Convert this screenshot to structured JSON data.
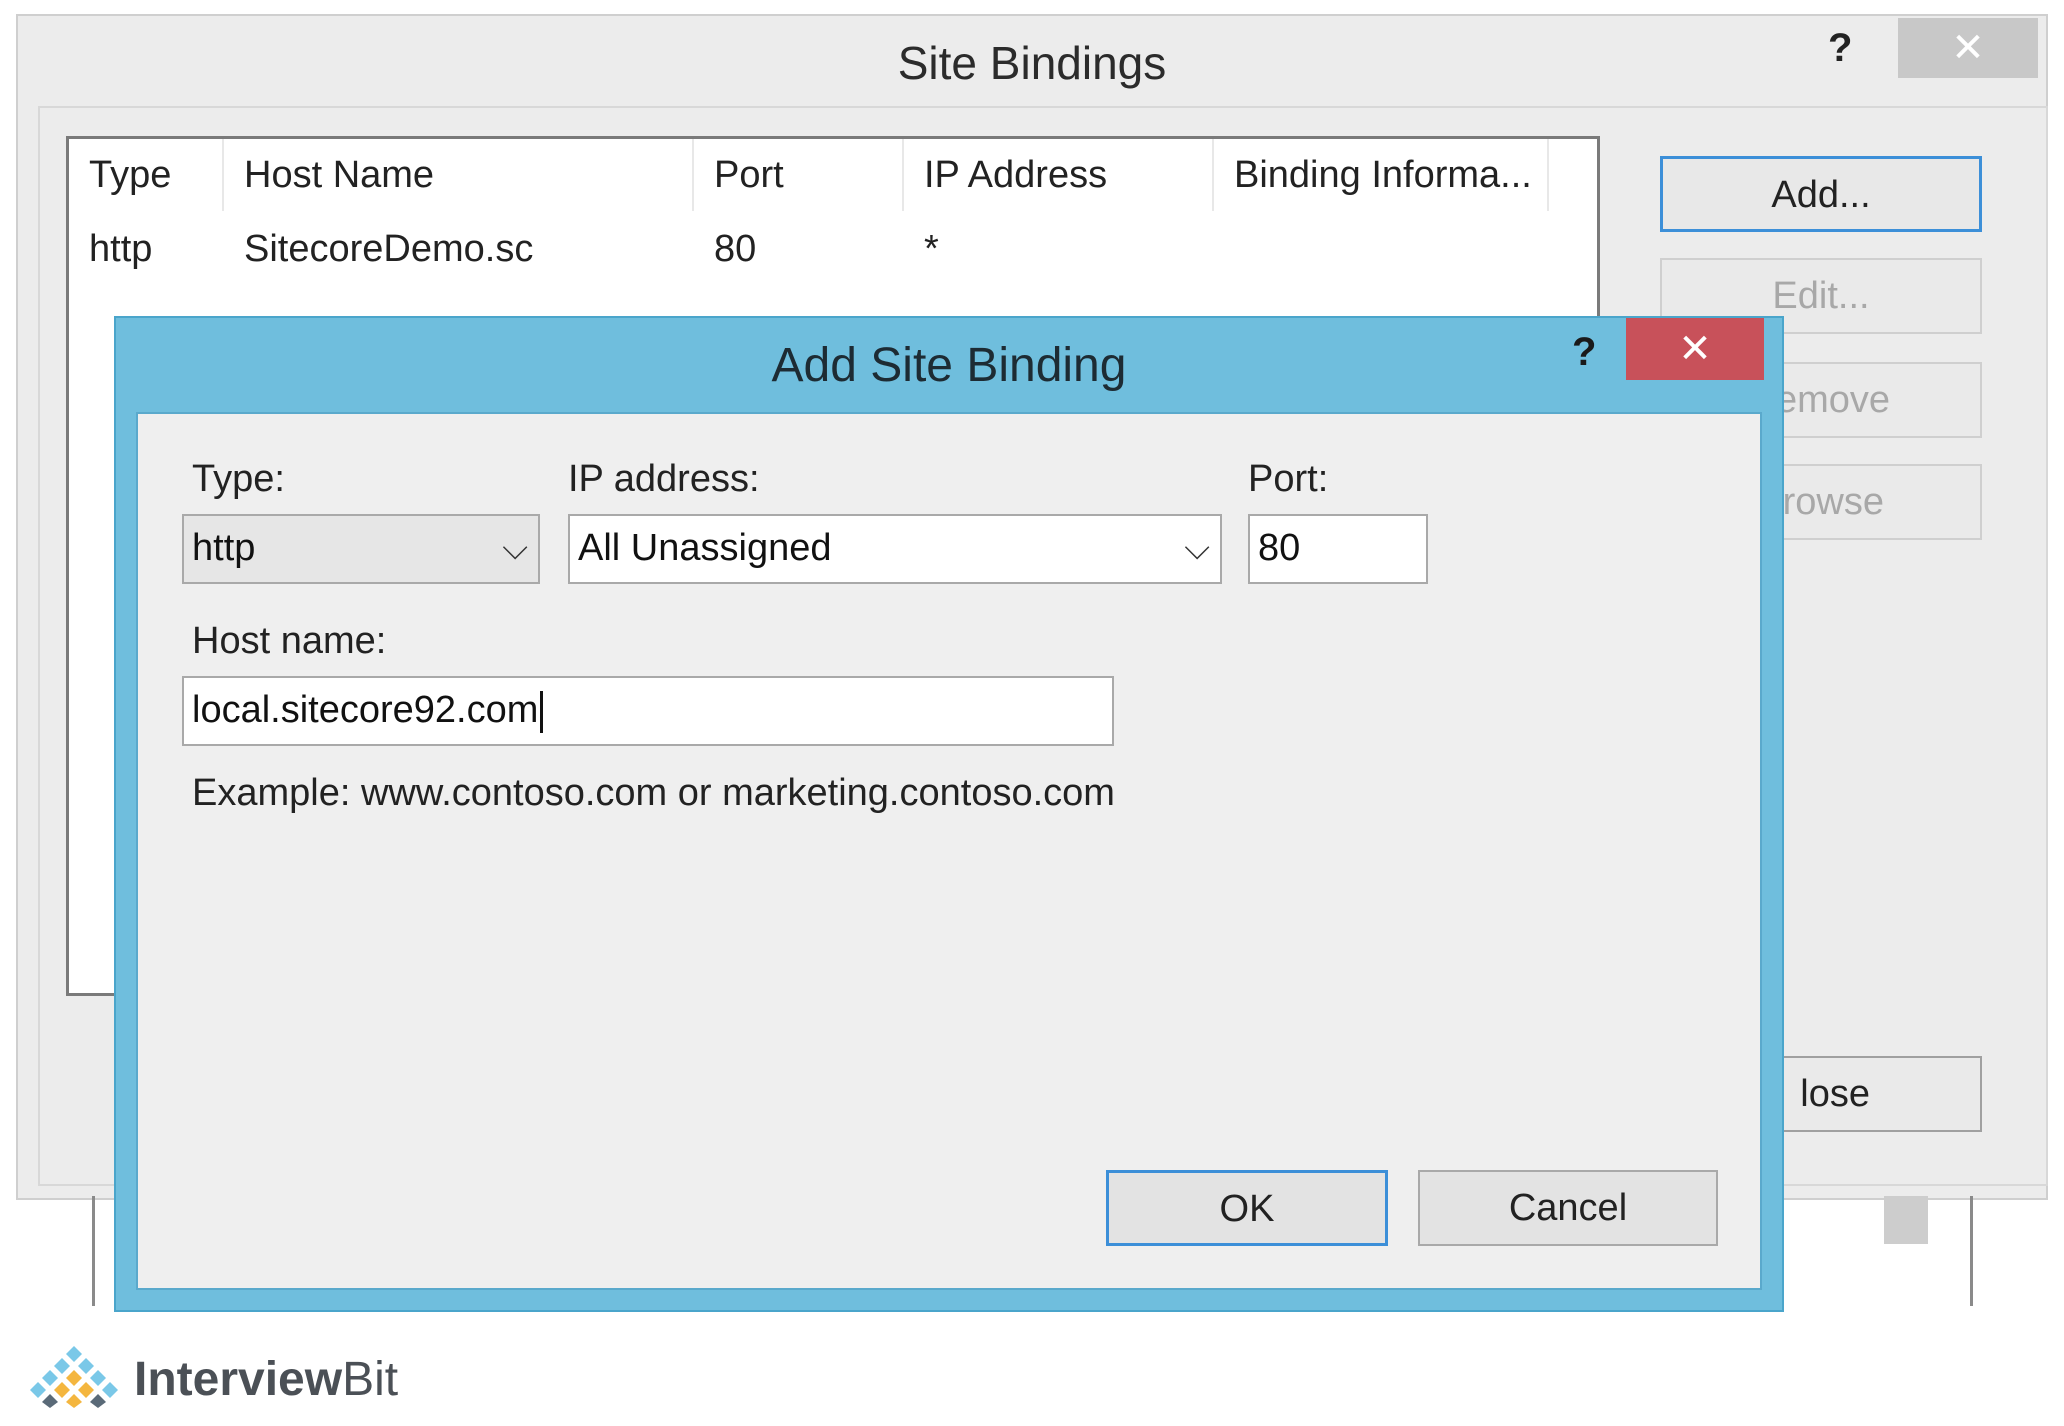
{
  "site_bindings": {
    "title": "Site Bindings",
    "help_glyph": "?",
    "close_glyph": "✕",
    "columns": [
      "Type",
      "Host Name",
      "Port",
      "IP Address",
      "Binding Informa..."
    ],
    "rows": [
      {
        "type": "http",
        "host_name": "SitecoreDemo.sc",
        "port": "80",
        "ip_address": "*",
        "binding_info": ""
      }
    ],
    "buttons": {
      "add": "Add...",
      "edit": "Edit...",
      "remove_partial": "emove",
      "browse_partial": "rowse",
      "close_partial": "lose"
    }
  },
  "add_site_binding": {
    "title": "Add Site Binding",
    "help_glyph": "?",
    "close_glyph": "✕",
    "type_label": "Type:",
    "type_value": "http",
    "ip_label": "IP address:",
    "ip_value": "All Unassigned",
    "port_label": "Port:",
    "port_value": "80",
    "host_label": "Host name:",
    "host_value": "local.sitecore92.com",
    "example": "Example: www.contoso.com or marketing.contoso.com",
    "ok": "OK",
    "cancel": "Cancel",
    "chevron_glyph": "⌵"
  },
  "logo": {
    "part1": "Interview",
    "part2": "Bit"
  },
  "colors": {
    "dialog_frame": "#6fbedd",
    "close_button_red": "#c8515a",
    "focus_blue": "#3c8fd8"
  }
}
